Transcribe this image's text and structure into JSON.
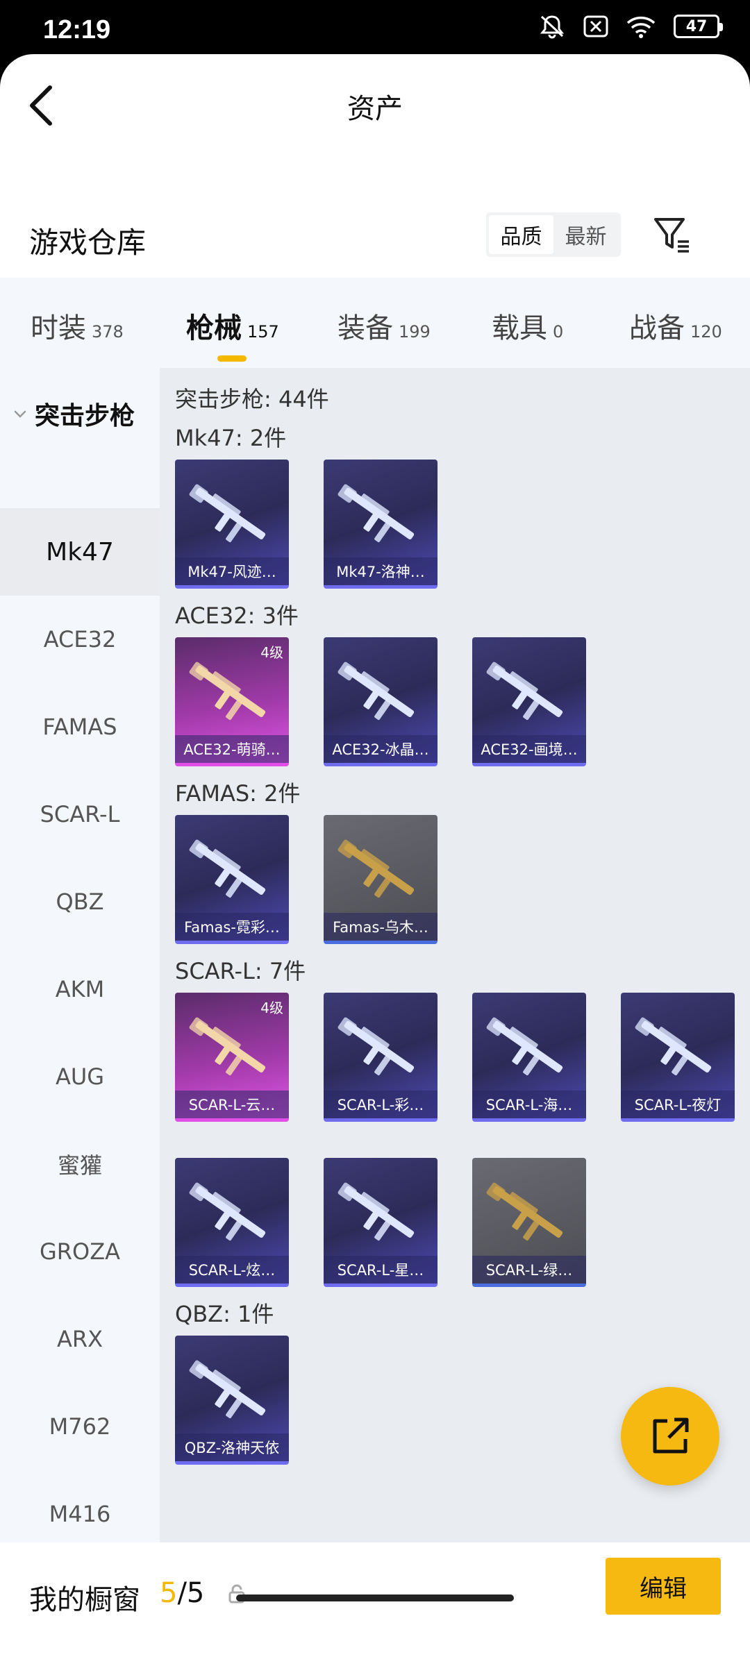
{
  "status_bar": {
    "time": "12:19",
    "battery": "47"
  },
  "header": {
    "title": "资产"
  },
  "repo": {
    "title": "游戏仓库",
    "sort_options": [
      "品质",
      "最新"
    ],
    "sort_active": "品质"
  },
  "tabs": [
    {
      "name": "时装",
      "count": "378"
    },
    {
      "name": "枪械",
      "count": "157",
      "active": true
    },
    {
      "name": "装备",
      "count": "199"
    },
    {
      "name": "载具",
      "count": "0"
    },
    {
      "name": "战备",
      "count": "120"
    }
  ],
  "sidebar": {
    "group": "突击步枪",
    "items": [
      "Mk47",
      "ACE32",
      "FAMAS",
      "SCAR-L",
      "QBZ",
      "AKM",
      "AUG",
      "蜜獾",
      "GROZA",
      "ARX",
      "M762",
      "M416"
    ],
    "active": "Mk47"
  },
  "content": {
    "summary": "突击步枪: 44件",
    "sections": [
      {
        "label": "Mk47: 2件",
        "items": [
          {
            "name": "Mk47-风迹…",
            "tier": "blue"
          },
          {
            "name": "Mk47-洛神…",
            "tier": "blue"
          }
        ]
      },
      {
        "label": "ACE32: 3件",
        "items": [
          {
            "name": "ACE32-萌骑…",
            "tier": "pink",
            "level": "4级"
          },
          {
            "name": "ACE32-冰晶…",
            "tier": "blue"
          },
          {
            "name": "ACE32-画境…",
            "tier": "blue"
          }
        ]
      },
      {
        "label": "FAMAS: 2件",
        "items": [
          {
            "name": "Famas-霓彩…",
            "tier": "blue"
          },
          {
            "name": "Famas-乌木…",
            "tier": "gray"
          }
        ]
      },
      {
        "label": "SCAR-L: 7件",
        "items": [
          {
            "name": "SCAR-L-云…",
            "tier": "pink",
            "level": "4级"
          },
          {
            "name": "SCAR-L-彩…",
            "tier": "blue"
          },
          {
            "name": "SCAR-L-海…",
            "tier": "blue"
          },
          {
            "name": "SCAR-L-夜灯",
            "tier": "blue"
          },
          {
            "name": "SCAR-L-炫…",
            "tier": "blue"
          },
          {
            "name": "SCAR-L-星…",
            "tier": "blue"
          },
          {
            "name": "SCAR-L-绿…",
            "tier": "gray"
          }
        ]
      },
      {
        "label": "QBZ: 1件",
        "items": [
          {
            "name": "QBZ-洛神天依",
            "tier": "blue"
          }
        ]
      }
    ]
  },
  "bottom": {
    "label": "我的橱窗",
    "used": "5",
    "total": "/5",
    "edit": "编辑"
  },
  "icons": {
    "back": "back-arrow-icon",
    "filter": "filter-icon",
    "fab": "share-external-icon",
    "lock": "lock-icon",
    "gun": "rifle-icon"
  },
  "colors": {
    "accent": "#f5b800",
    "tier_blue": "#3c3a74",
    "tier_pink": "#e255e8",
    "tier_gray": "#5c5d64"
  }
}
